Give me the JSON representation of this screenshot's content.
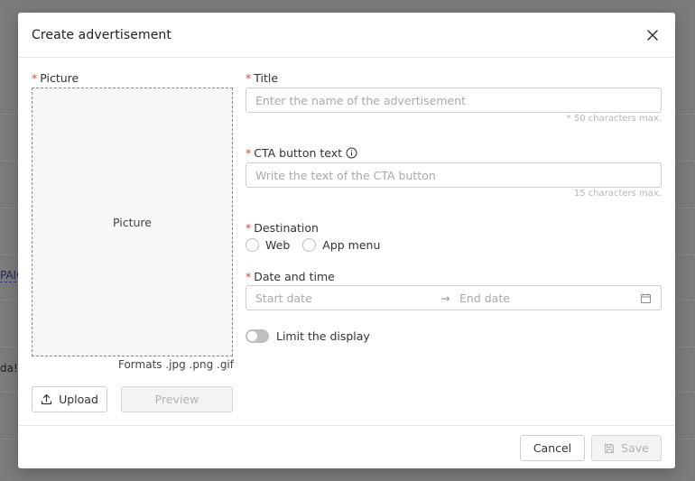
{
  "background": {
    "fragment_campaign": "PAIG",
    "fragment_name": "da!"
  },
  "modal": {
    "title": "Create advertisement",
    "picture": {
      "label": "Picture",
      "placeholder": "Picture",
      "formats": "Formats .jpg .png .gif",
      "upload_label": "Upload",
      "preview_label": "Preview"
    },
    "title_field": {
      "label": "Title",
      "placeholder": "Enter the name of the advertisement",
      "hint": "* 50 characters max."
    },
    "cta_field": {
      "label": "CTA button text",
      "placeholder": "Write the text of the CTA button",
      "hint": "15 characters max."
    },
    "destination": {
      "label": "Destination",
      "options": [
        "Web",
        "App menu"
      ]
    },
    "date_time": {
      "label": "Date and time",
      "start_placeholder": "Start date",
      "arrow": "→",
      "end_placeholder": "End date"
    },
    "limit_display": {
      "label": "Limit the display",
      "enabled": false
    },
    "footer": {
      "cancel_label": "Cancel",
      "save_label": "Save"
    }
  },
  "required_marker": "*",
  "icons": {
    "close": "close-icon",
    "info": "info-icon",
    "upload": "upload-icon",
    "calendar": "calendar-icon",
    "save": "save-icon"
  },
  "colors": {
    "required": "#e0463a",
    "overlay": "#7c7c7c"
  }
}
